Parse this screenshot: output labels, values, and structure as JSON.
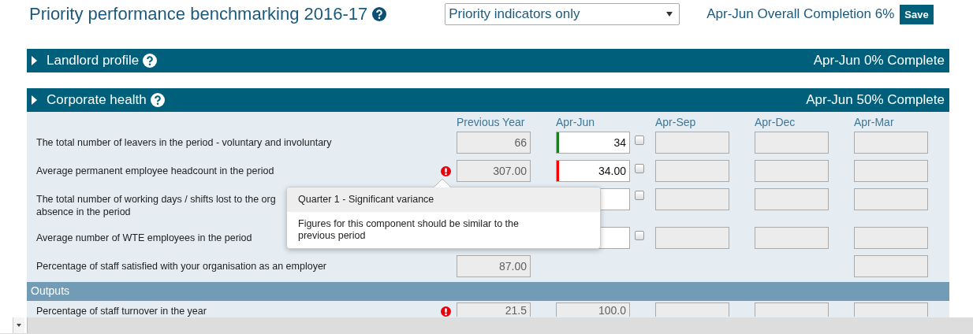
{
  "header": {
    "title": "Priority performance benchmarking 2016-17",
    "filter": {
      "value": "Priority indicators only"
    },
    "completion": "Apr-Jun Overall Completion 6%",
    "save_button": "Save"
  },
  "sections": [
    {
      "title": "Landlord profile",
      "status": "Apr-Jun 0% Complete"
    },
    {
      "title": "Corporate health",
      "status": "Apr-Jun 50% Complete",
      "columns": [
        "Previous Year",
        "Apr-Jun",
        "Apr-Sep",
        "Apr-Dec",
        "Apr-Mar"
      ],
      "groups": [
        {
          "rows": [
            {
              "label": [
                "The total number of leavers in the period - voluntary and involuntary"
              ],
              "warning": false,
              "checked": false,
              "previous_year": {
                "editable": false,
                "value": "66"
              },
              "apr_jun": {
                "editable": true,
                "value": "34",
                "color": "#16801e"
              },
              "apr_sep": {
                "editable": false
              },
              "apr_dec": {
                "editable": false
              },
              "apr_mar": {
                "editable": false
              }
            },
            {
              "label": [
                "Average permanent employee headcount in the period"
              ],
              "warning": true,
              "checked": false,
              "previous_year": {
                "editable": false,
                "value": "307.00"
              },
              "apr_jun": {
                "editable": true,
                "value": "34.00",
                "color": "#ff0000"
              },
              "apr_sep": {
                "editable": false
              },
              "apr_dec": {
                "editable": false
              },
              "apr_mar": {
                "editable": false
              }
            },
            {
              "label": [
                "The total number of working days / shifts lost to the org",
                "absence in the period"
              ],
              "warning": false,
              "checked": false,
              "apr_jun": {
                "editable": true
              },
              "apr_sep": {
                "editable": false
              },
              "apr_dec": {
                "editable": false
              },
              "apr_mar": {
                "editable": false
              }
            },
            {
              "label": [
                "Average number of WTE employees in the period"
              ],
              "warning": false,
              "checked": false,
              "apr_jun": {
                "editable": true
              },
              "apr_sep": {
                "editable": false
              },
              "apr_dec": {
                "editable": false
              },
              "apr_mar": {
                "editable": false
              }
            },
            {
              "label": [
                "Percentage of staff satisfied with your organisation as an employer"
              ],
              "warning": false,
              "previous_year": {
                "editable": false,
                "value": "87.00"
              },
              "apr_mar": {
                "editable": false
              }
            }
          ]
        },
        {
          "title": "Outputs",
          "rows": [
            {
              "label": [
                "Percentage of staff turnover in the year"
              ],
              "warning": true,
              "previous_year": {
                "editable": false,
                "value": "21.5"
              },
              "apr_jun": {
                "editable": false,
                "value": "100.0"
              },
              "apr_sep": {
                "editable": false
              },
              "apr_dec": {
                "editable": false
              },
              "apr_mar": {
                "editable": false
              }
            }
          ]
        }
      ]
    }
  ],
  "tooltip": {
    "title": "Quarter 1 - Significant variance",
    "text": "Figures for this component should be similar to the previous period"
  }
}
